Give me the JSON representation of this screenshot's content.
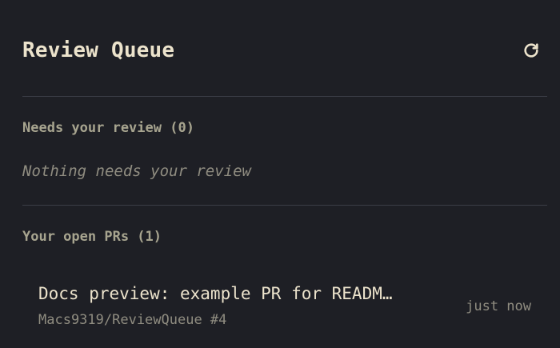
{
  "app": {
    "title": "Review Queue",
    "refresh_icon": "refresh-icon"
  },
  "sections": {
    "needs_review": {
      "heading": "Needs your review (0)",
      "empty_text": "Nothing needs your review"
    },
    "open_prs": {
      "heading": "Your open PRs (1)",
      "items": [
        {
          "title": "Docs preview: example PR for READM…",
          "repo": "Macs9319/ReviewQueue #4",
          "time": "just now"
        }
      ]
    }
  },
  "colors": {
    "background": "#1e1f25",
    "title": "#ece3cc",
    "heading": "#a7a48f",
    "muted": "#8f8c80",
    "divider": "#3b3d46"
  }
}
